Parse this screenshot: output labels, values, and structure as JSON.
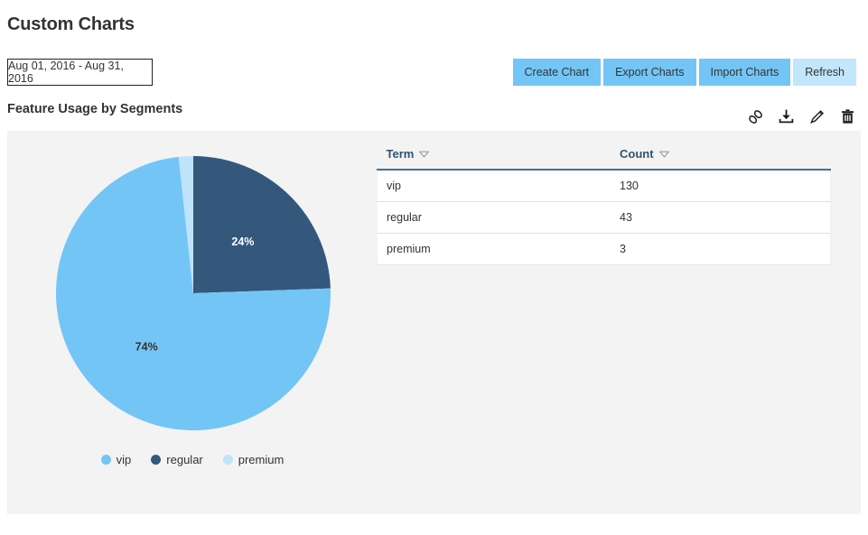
{
  "header": {
    "title": "Custom Charts"
  },
  "date_range": {
    "label": "Aug 01, 2016 - Aug 31, 2016"
  },
  "toolbar": {
    "buttons": [
      {
        "label": "Create Chart",
        "style": "primary"
      },
      {
        "label": "Export Charts",
        "style": "primary"
      },
      {
        "label": "Import Charts",
        "style": "primary"
      },
      {
        "label": "Refresh",
        "style": "light"
      }
    ],
    "primary_color": "#73c5f6",
    "light_color": "#c2e6fc"
  },
  "chart_section": {
    "title": "Feature Usage by Segments",
    "icons": [
      {
        "name": "link-icon"
      },
      {
        "name": "download-icon"
      },
      {
        "name": "edit-pencil-icon"
      },
      {
        "name": "trash-delete-icon"
      }
    ]
  },
  "table": {
    "columns": [
      "Term",
      "Count"
    ],
    "rows": [
      {
        "term": "vip",
        "count": "130"
      },
      {
        "term": "regular",
        "count": "43"
      },
      {
        "term": "premium",
        "count": "3"
      }
    ],
    "header_color": "#2d5372",
    "header_rule_color": "#3f6f9f"
  },
  "legend": {
    "items": [
      {
        "label": "vip",
        "color": "#73c5f6"
      },
      {
        "label": "regular",
        "color": "#33587c"
      },
      {
        "label": "premium",
        "color": "#bfe3fb"
      }
    ]
  },
  "chart_data": {
    "type": "pie",
    "title": "Feature Usage by Segments",
    "categories": [
      "vip",
      "regular",
      "premium"
    ],
    "values": [
      130,
      43,
      3
    ],
    "percent_labels": [
      "74%",
      "24%",
      ""
    ],
    "percents": [
      73.9,
      24.4,
      1.7
    ],
    "colors": [
      "#73c5f6",
      "#33587c",
      "#bfe3fb"
    ],
    "slice_label_colors": [
      "#333333",
      "#ffffff",
      "#333333"
    ],
    "start_angle_deg": 0,
    "direction": "clockwise",
    "legend_position": "bottom",
    "grid": false,
    "xlabel": "",
    "ylabel": "",
    "panel_background": "#f3f3f3"
  },
  "slice_labels": {
    "regular": "24%",
    "vip": "74%"
  }
}
